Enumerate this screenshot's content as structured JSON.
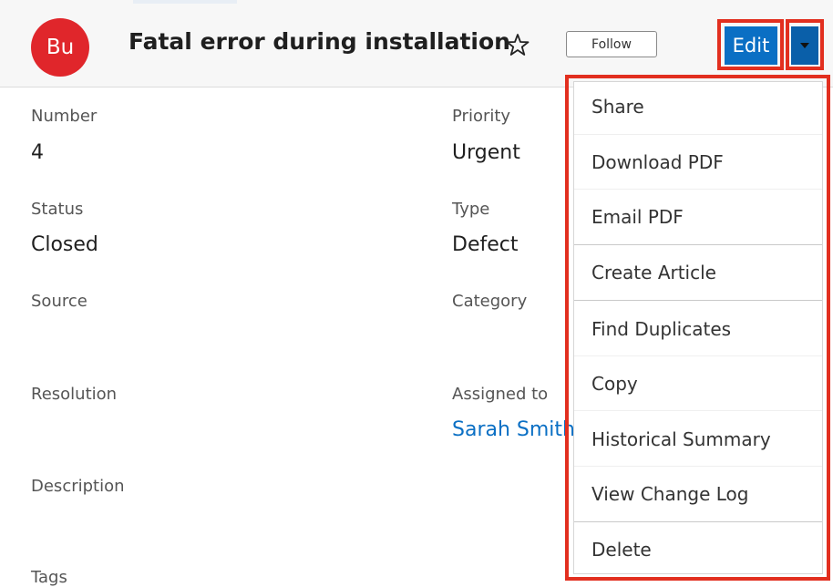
{
  "record": {
    "avatar_initials": "Bu",
    "title": "Fatal error during installation",
    "follow_label": "Follow",
    "edit_label": "Edit"
  },
  "fields": {
    "number_label": "Number",
    "number_value": "4",
    "priority_label": "Priority",
    "priority_value": "Urgent",
    "status_label": "Status",
    "status_value": "Closed",
    "type_label": "Type",
    "type_value": "Defect",
    "source_label": "Source",
    "category_label": "Category",
    "resolution_label": "Resolution",
    "assigned_label": "Assigned to",
    "assigned_value": "Sarah Smith",
    "description_label": "Description",
    "tags_label": "Tags"
  },
  "menu": {
    "items": [
      "Share",
      "Download PDF",
      "Email PDF",
      "Create Article",
      "Find Duplicates",
      "Copy",
      "Historical Summary",
      "View Change Log",
      "Delete"
    ]
  },
  "colors": {
    "avatar_bg": "#e0262b",
    "edit_button": "#0a6fc4",
    "highlight": "#e22f1f",
    "link": "#0a6fc4"
  },
  "icons": {
    "favorite": "star-outline-icon",
    "actions": "caret-down-icon"
  }
}
